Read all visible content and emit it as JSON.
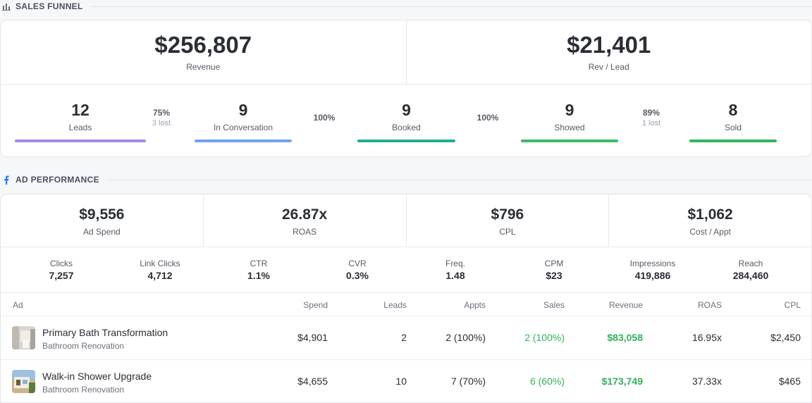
{
  "sales_funnel": {
    "title": "SALES FUNNEL",
    "revenue": {
      "value": "$256,807",
      "label": "Revenue"
    },
    "rev_per_lead": {
      "value": "$21,401",
      "label": "Rev / Lead"
    },
    "stages": [
      {
        "count": "12",
        "label": "Leads",
        "color": "#a78bdc"
      },
      {
        "count": "9",
        "label": "In Conversation",
        "color": "#6fa3e6"
      },
      {
        "count": "9",
        "label": "Booked",
        "color": "#1fae91"
      },
      {
        "count": "9",
        "label": "Showed",
        "color": "#3dbd63"
      },
      {
        "count": "8",
        "label": "Sold",
        "color": "#2fb85a"
      }
    ],
    "conversions": [
      {
        "pct": "75%",
        "lost": "3 lost"
      },
      {
        "pct": "100%",
        "lost": ""
      },
      {
        "pct": "100%",
        "lost": ""
      },
      {
        "pct": "89%",
        "lost": "1 lost"
      }
    ]
  },
  "ad_performance": {
    "title": "AD PERFORMANCE",
    "kpis": [
      {
        "value": "$9,556",
        "label": "Ad Spend"
      },
      {
        "value": "26.87x",
        "label": "ROAS"
      },
      {
        "value": "$796",
        "label": "CPL"
      },
      {
        "value": "$1,062",
        "label": "Cost / Appt"
      }
    ],
    "metrics": [
      {
        "label": "Clicks",
        "value": "7,257"
      },
      {
        "label": "Link Clicks",
        "value": "4,712"
      },
      {
        "label": "CTR",
        "value": "1.1%"
      },
      {
        "label": "CVR",
        "value": "0.3%"
      },
      {
        "label": "Freq.",
        "value": "1.48"
      },
      {
        "label": "CPM",
        "value": "$23"
      },
      {
        "label": "Impressions",
        "value": "419,886"
      },
      {
        "label": "Reach",
        "value": "284,460"
      }
    ],
    "table": {
      "headers": [
        "Ad",
        "Spend",
        "Leads",
        "Appts",
        "Sales",
        "Revenue",
        "ROAS",
        "CPL"
      ],
      "rows": [
        {
          "name": "Primary Bath Transformation",
          "category": "Bathroom Renovation",
          "spend": "$4,901",
          "leads": "2",
          "appts": "2 (100%)",
          "sales": "2 (100%)",
          "revenue": "$83,058",
          "roas": "16.95x",
          "cpl": "$2,450"
        },
        {
          "name": "Walk-in Shower Upgrade",
          "category": "Bathroom Renovation",
          "spend": "$4,655",
          "leads": "10",
          "appts": "7 (70%)",
          "sales": "6 (60%)",
          "revenue": "$173,749",
          "roas": "37.33x",
          "cpl": "$465"
        }
      ]
    }
  },
  "icons": {
    "funnel_section": "bar-chart-icon",
    "ad_section": "facebook-icon"
  },
  "colors": {
    "positive": "#2fb25a",
    "facebook": "#1877f2"
  }
}
